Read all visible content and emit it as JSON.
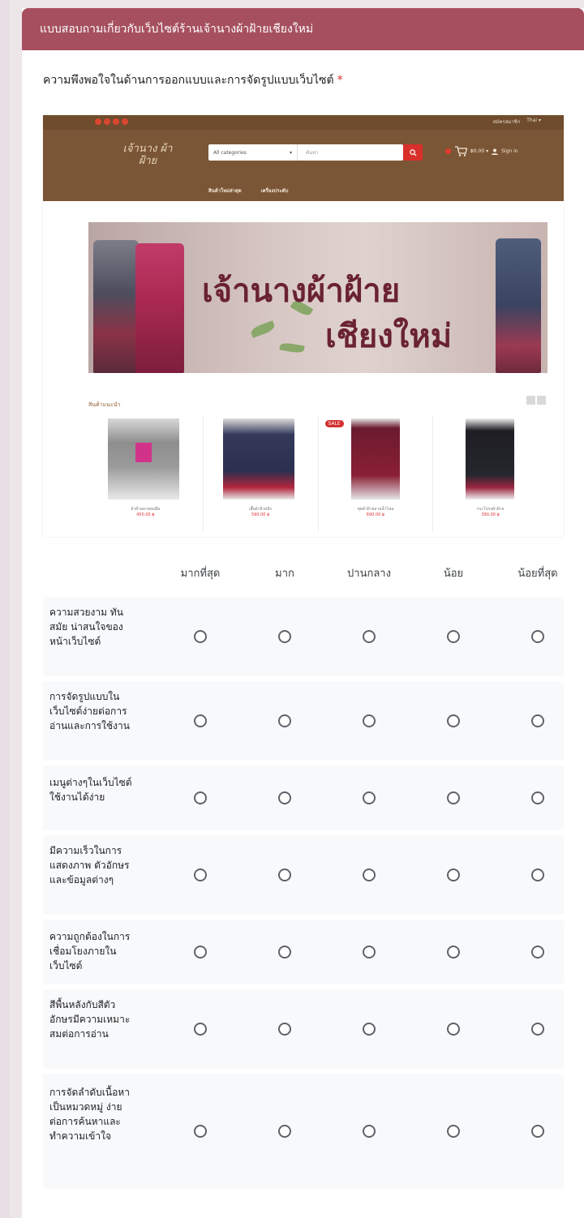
{
  "form": {
    "title": "แบบสอบถามเกี่ยวกับเว็บไซต์ร้านเจ้านางผ้าฝ้ายเชียงใหม่",
    "question": "ความพึงพอใจในด้านการออกแบบและการจัดรูปแบบเว็บไซต์",
    "required_mark": "*"
  },
  "screenshot": {
    "logo": "เจ้านาง ผ้าฝ้าย",
    "search_category": "All categories",
    "search_placeholder": "ค้นหา",
    "top_links": [
      "สมัครสมาชิก",
      "Thai ▾"
    ],
    "cart_text": "฿0.00 ▾",
    "login_text": "Sign in",
    "nav": [
      "สินค้าใหม่ล่าสุด",
      "เครื่องประดับ"
    ],
    "banner_line1": "เจ้านางผ้าฝ้าย",
    "banner_line2": "เชียงใหม่",
    "recommended": "สินค้าแนะนำ",
    "sale_badge": "SALE",
    "products": [
      {
        "name": "ผ้าฝ้ายลายทอมือ",
        "price": "450.00 ฿"
      },
      {
        "name": "เสื้อผ้าฝ้ายปัก",
        "price": "590.00 ฿"
      },
      {
        "name": "ชุดผ้าฝ้ายลายน้ำไหล",
        "price": "690.00 ฿"
      },
      {
        "name": "กระโปรงผ้าฝ้าย",
        "price": "390.00 ฿"
      }
    ]
  },
  "grid": {
    "columns": [
      "มากที่สุด",
      "มาก",
      "ปานกลาง",
      "น้อย",
      "น้อยที่สุด"
    ],
    "rows": [
      "ความสวยงาม ทันสมัย น่าสนใจของหน้าเว็บไซต์",
      "การจัดรูปแบบในเว็บไซต์ง่ายต่อการอ่านและการใช้งาน",
      "เมนูต่างๆในเว็บไซต์ใช้งานได้ง่าย",
      "มีความเร็วในการแสดงภาพ ตัวอักษร และข้อมูลต่างๆ",
      "ความถูกต้องในการเชื่อมโยงภายในเว็บไซต์",
      "สีพื้นหลังกับสีตัวอักษรมีความเหมาะสมต่อการอ่าน",
      "การจัดลำดับเนื้อหาเป็นหมวดหมู่ ง่ายต่อการค้นหาและทำความเข้าใจ"
    ]
  },
  "colors": {
    "header": "#a6505f",
    "site_header": "#7b5636",
    "accent_red": "#d8302a"
  }
}
